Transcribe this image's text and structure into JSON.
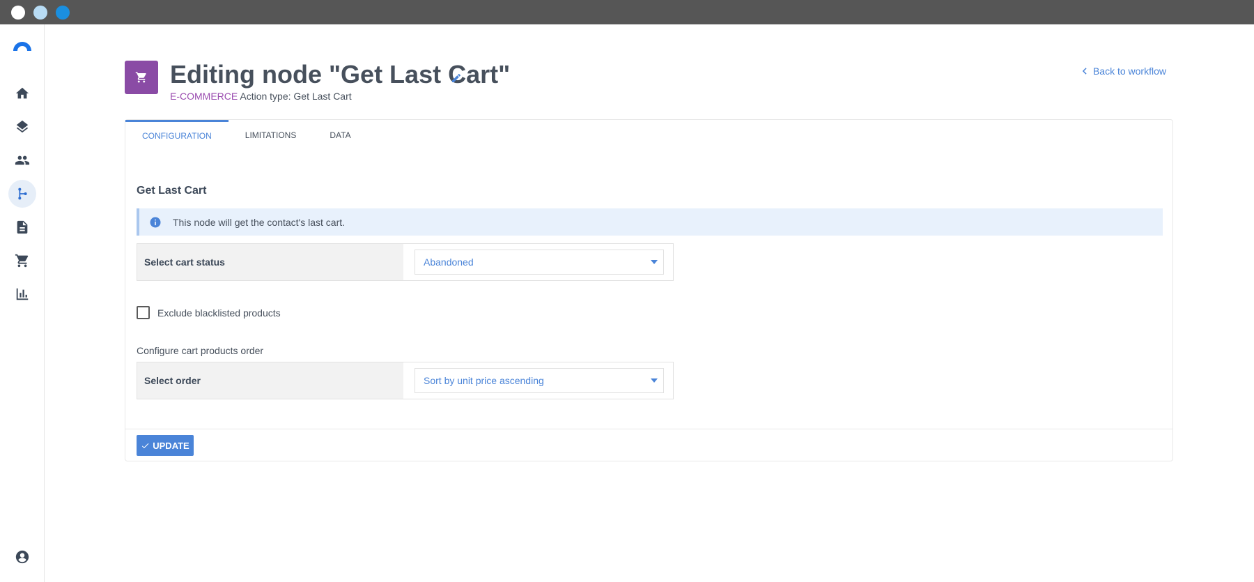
{
  "window": {
    "controls": [
      "close",
      "minimize",
      "maximize"
    ]
  },
  "sidebar": {
    "logo": "brand-logo",
    "items": [
      {
        "icon": "home-icon"
      },
      {
        "icon": "layers-icon"
      },
      {
        "icon": "contacts-icon"
      },
      {
        "icon": "workflow-icon",
        "active": true
      },
      {
        "icon": "document-icon"
      },
      {
        "icon": "cart-icon"
      },
      {
        "icon": "chart-icon"
      }
    ],
    "bottom_icon": "account-icon"
  },
  "header": {
    "title": "Editing node \"Get Last Cart\"",
    "category": "E-COMMERCE",
    "action_type": " Action type: Get Last Cart",
    "back_link": "Back to workflow",
    "node_color": "#8a4ba5"
  },
  "tabs": [
    {
      "label": "CONFIGURATION",
      "active": true
    },
    {
      "label": "LIMITATIONS",
      "active": false
    },
    {
      "label": "DATA",
      "active": false
    }
  ],
  "config": {
    "section_title": "Get Last Cart",
    "info_text": "This node will get the contact's last cart.",
    "cart_status_label": "Select cart status",
    "cart_status_value": "Abandoned",
    "exclude_label": "Exclude blacklisted products",
    "exclude_checked": false,
    "order_section_label": "Configure cart products order",
    "order_label": "Select order",
    "order_value": "Sort by unit price ascending"
  },
  "footer": {
    "update_label": "UPDATE"
  },
  "colors": {
    "accent": "#4a84d8",
    "category": "#9b4db0"
  }
}
